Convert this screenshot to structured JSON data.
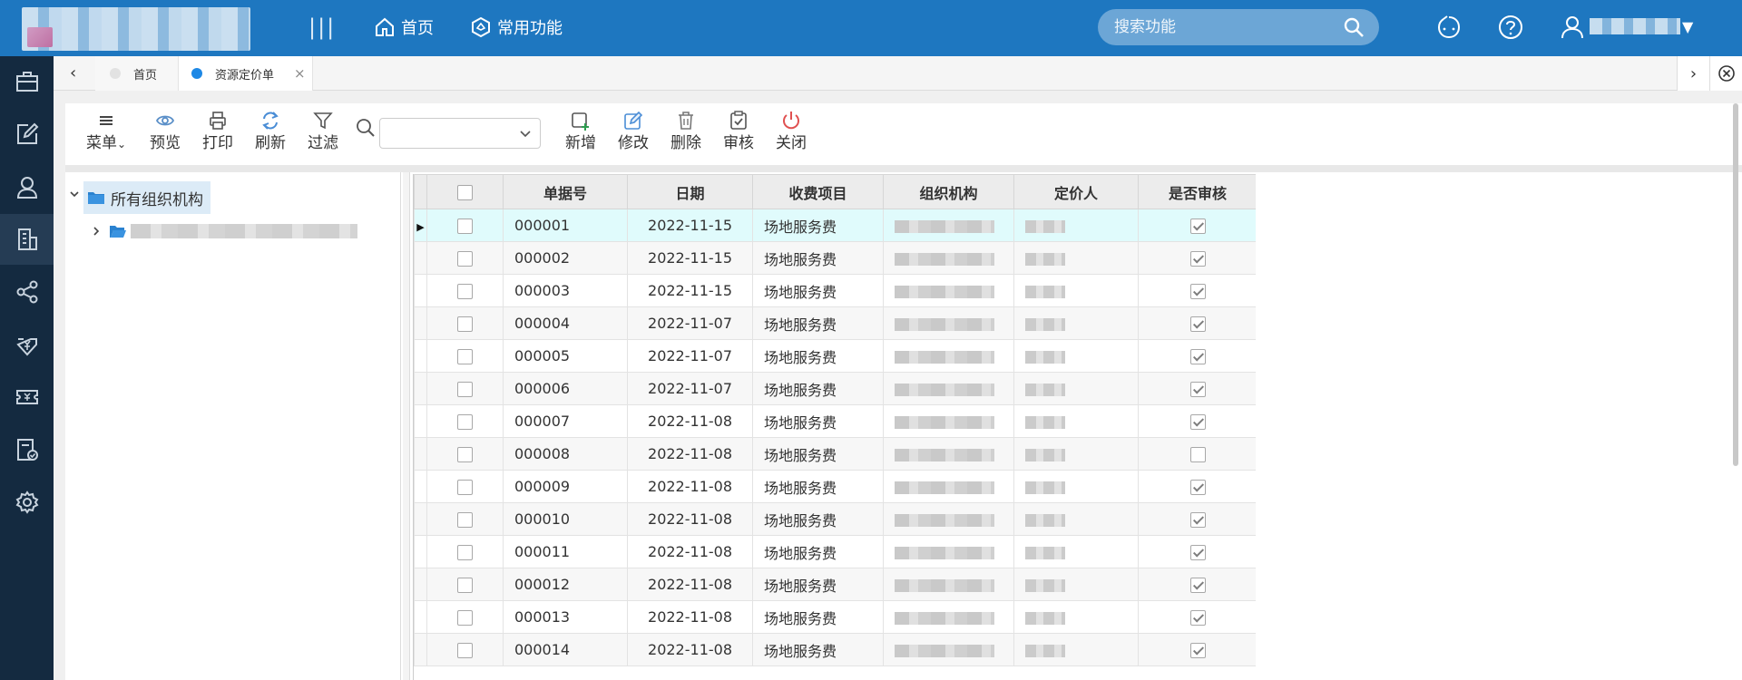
{
  "header": {
    "nav_home": "首页",
    "nav_common": "常用功能",
    "search_placeholder": "搜索功能"
  },
  "tabs": [
    {
      "label": "首页"
    },
    {
      "label": "资源定价单"
    }
  ],
  "toolbar": {
    "menu": "菜单",
    "preview": "预览",
    "print": "打印",
    "refresh": "刷新",
    "filter": "过滤",
    "add": "新增",
    "edit": "修改",
    "delete": "删除",
    "audit": "审核",
    "close": "关闭"
  },
  "tree": {
    "root_label": "所有组织机构"
  },
  "grid": {
    "headers": {
      "no": "单据号",
      "date": "日期",
      "item": "收费项目",
      "org": "组织机构",
      "pricer": "定价人",
      "audited": "是否审核"
    },
    "rows": [
      {
        "no": "000001",
        "date": "2022-11-15",
        "item": "场地服务费",
        "audited": true
      },
      {
        "no": "000002",
        "date": "2022-11-15",
        "item": "场地服务费",
        "audited": true
      },
      {
        "no": "000003",
        "date": "2022-11-15",
        "item": "场地服务费",
        "audited": true
      },
      {
        "no": "000004",
        "date": "2022-11-07",
        "item": "场地服务费",
        "audited": true
      },
      {
        "no": "000005",
        "date": "2022-11-07",
        "item": "场地服务费",
        "audited": true
      },
      {
        "no": "000006",
        "date": "2022-11-07",
        "item": "场地服务费",
        "audited": true
      },
      {
        "no": "000007",
        "date": "2022-11-08",
        "item": "场地服务费",
        "audited": true
      },
      {
        "no": "000008",
        "date": "2022-11-08",
        "item": "场地服务费",
        "audited": false
      },
      {
        "no": "000009",
        "date": "2022-11-08",
        "item": "场地服务费",
        "audited": true
      },
      {
        "no": "000010",
        "date": "2022-11-08",
        "item": "场地服务费",
        "audited": true
      },
      {
        "no": "000011",
        "date": "2022-11-08",
        "item": "场地服务费",
        "audited": true
      },
      {
        "no": "000012",
        "date": "2022-11-08",
        "item": "场地服务费",
        "audited": true
      },
      {
        "no": "000013",
        "date": "2022-11-08",
        "item": "场地服务费",
        "audited": true
      },
      {
        "no": "000014",
        "date": "2022-11-08",
        "item": "场地服务费",
        "audited": true
      }
    ]
  },
  "colors": {
    "header_bg": "#1e77c0",
    "sidebar_bg": "#142a40",
    "selected_row": "#e0fbfc",
    "tab_active_dot": "#1e88e5",
    "close_icon": "#e05050",
    "add_icon": "#2e9c4f"
  },
  "icons": {
    "sidebar": [
      "briefcase-icon",
      "edit-icon",
      "user-icon",
      "building-icon",
      "share-icon",
      "download-yen-icon",
      "ticket-icon",
      "document-check-icon",
      "gear-icon"
    ],
    "header": [
      "home-icon",
      "hexagon-icon",
      "search-icon",
      "chat-icon",
      "help-icon",
      "user-icon",
      "caret-down-icon"
    ]
  }
}
